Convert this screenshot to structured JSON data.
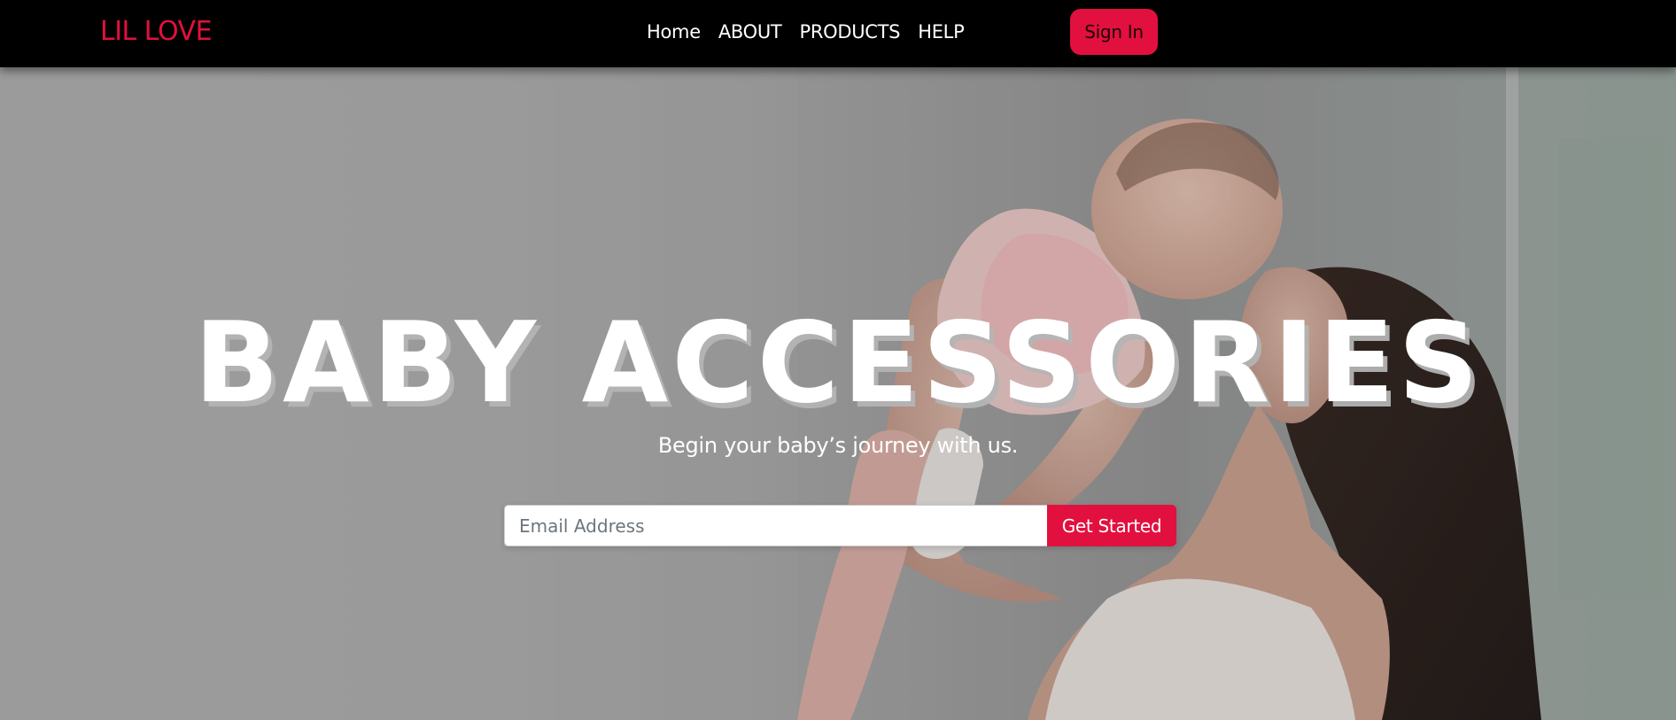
{
  "navbar": {
    "brand": "LIL LOVE",
    "links": [
      "Home",
      "ABOUT",
      "PRODUCTS",
      "HELP"
    ],
    "signin_label": "Sign In"
  },
  "hero": {
    "headline": "BABY ACCESSORIES",
    "tagline": "Begin your baby’s journey with us.",
    "email_placeholder": "Email Address",
    "cta_label": "Get Started",
    "background_photo": "mother-lifting-baby-photo"
  },
  "colors": {
    "accent": "#e2103e",
    "navbar_bg": "#000000",
    "text_light": "#ffffff"
  }
}
